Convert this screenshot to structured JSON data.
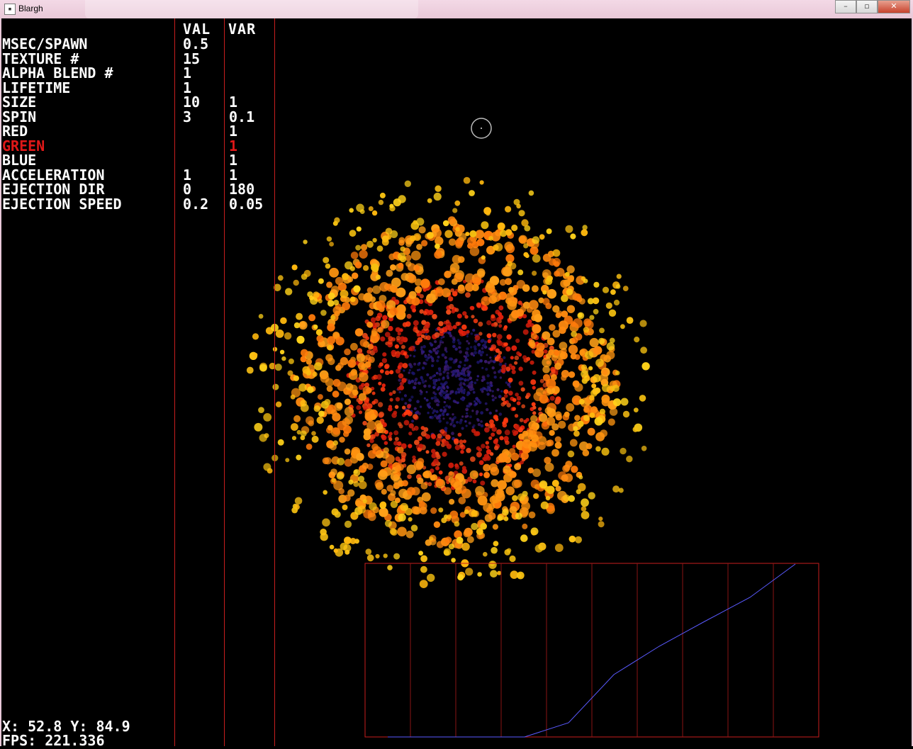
{
  "window": {
    "title": "Blargh",
    "title_icon": "app-icon",
    "buttons": [
      "minimize",
      "maximize",
      "close"
    ]
  },
  "table": {
    "headers": {
      "val": "VAL",
      "var": "VAR"
    },
    "rows": [
      {
        "label": "MSEC/SPAWN",
        "val": "0.5",
        "var": ""
      },
      {
        "label": "TEXTURE #",
        "val": "15",
        "var": ""
      },
      {
        "label": "ALPHA BLEND #",
        "val": "1",
        "var": ""
      },
      {
        "label": "LIFETIME",
        "val": "1",
        "var": ""
      },
      {
        "label": "SIZE",
        "val": "10",
        "var": "1"
      },
      {
        "label": "SPIN",
        "val": "3",
        "var": "0.1"
      },
      {
        "label": "RED",
        "val": "",
        "var": "1"
      },
      {
        "label": "GREEN",
        "val": "",
        "var": "1"
      },
      {
        "label": "BLUE",
        "val": "",
        "var": "1"
      },
      {
        "label": "ACCELERATION",
        "val": "1",
        "var": "1"
      },
      {
        "label": "EJECTION DIR",
        "val": "0",
        "var": "180"
      },
      {
        "label": "EJECTION SPEED",
        "val": "0.2",
        "var": "0.05"
      }
    ],
    "selected_row": "GREEN"
  },
  "status": {
    "coords": "X: 52.8 Y: 84.9",
    "fps": "FPS: 221.336"
  },
  "colors": {
    "grid_red": "#c81e1e",
    "selected_red": "#e01818",
    "curve_blue": "#5a5aff"
  }
}
